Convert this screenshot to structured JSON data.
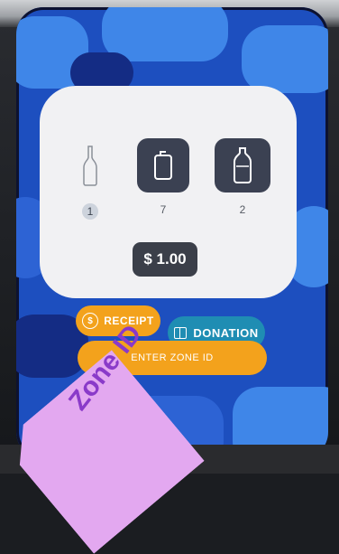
{
  "items": [
    {
      "name": "glass-bottle",
      "count": "1"
    },
    {
      "name": "can",
      "count": "7"
    },
    {
      "name": "plastic-bottle",
      "count": "2"
    }
  ],
  "total": "$ 1.00",
  "buttons": {
    "receipt": "RECEIPT",
    "donation": "DONATION",
    "zone_id": "ENTER ZONE ID"
  },
  "sticker": "Zone ID",
  "icons": {
    "receipt": "dollar-circle-icon",
    "donation": "gift-icon",
    "glass": "glass-bottle-icon",
    "can": "can-icon",
    "plastic": "plastic-bottle-icon"
  },
  "colors": {
    "screen_bg": "#1d4fbf",
    "card_bg": "#f1f1f3",
    "active_tile": "#3b4152",
    "orange": "#f3a21c",
    "teal": "#1f8db3",
    "sticker": "#e3a8f0"
  }
}
